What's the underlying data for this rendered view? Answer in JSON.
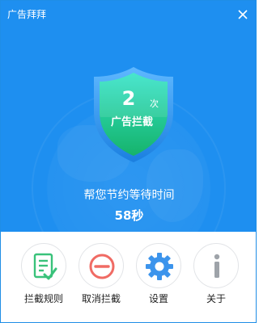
{
  "window": {
    "title": "广告拜拜"
  },
  "shield": {
    "count": "2",
    "unit": "次",
    "label": "广告拦截"
  },
  "status": {
    "saving_text": "帮您节约等待时间",
    "saving_time": "58秒"
  },
  "actions": [
    {
      "label": "拦截规则",
      "icon": "rules-icon"
    },
    {
      "label": "取消拦截",
      "icon": "cancel-icon"
    },
    {
      "label": "设置",
      "icon": "gear-icon"
    },
    {
      "label": "关于",
      "icon": "info-icon"
    }
  ],
  "colors": {
    "header_bg": "#1e8ff0",
    "shield_top": "#2fe0c4",
    "shield_bottom": "#14b86f",
    "rules_green": "#39c27a",
    "cancel_red": "#f06b64",
    "gear_blue": "#3c94ec",
    "info_gray": "#9ea3a9"
  }
}
